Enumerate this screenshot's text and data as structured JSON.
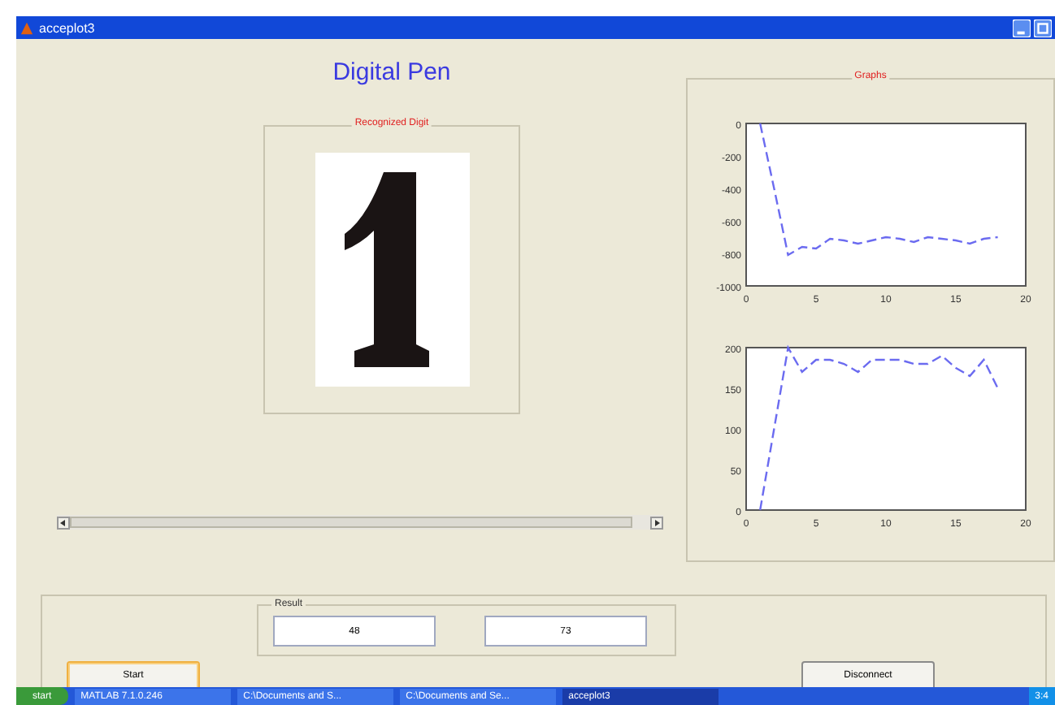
{
  "window": {
    "title": "acceplot3"
  },
  "heading": "Digital Pen",
  "digit_panel": {
    "title": "Recognized Digit"
  },
  "graphs_panel": {
    "title": "Graphs",
    "charts": [
      {
        "chart_data": {
          "type": "line",
          "x": [
            1,
            2,
            3,
            4,
            5,
            6,
            7,
            8,
            9,
            10,
            11,
            12,
            13,
            14,
            15,
            16,
            17,
            18
          ],
          "series": [
            {
              "color": "#6b6bf0",
              "line_style": "dashed",
              "values": [
                0,
                -400,
                -810,
                -760,
                -770,
                -710,
                -720,
                -740,
                -720,
                -700,
                -710,
                -730,
                -700,
                -710,
                -720,
                -740,
                -710,
                -700
              ]
            }
          ],
          "xlim": [
            0,
            20
          ],
          "ylim": [
            -1000,
            0
          ],
          "xticks": [
            0,
            5,
            10,
            15,
            20
          ],
          "yticks": [
            0,
            -200,
            -400,
            -600,
            -800,
            -1000
          ]
        }
      },
      {
        "chart_data": {
          "type": "line",
          "x": [
            1,
            2,
            3,
            4,
            5,
            6,
            7,
            8,
            9,
            10,
            11,
            12,
            13,
            14,
            15,
            16,
            17,
            18
          ],
          "series": [
            {
              "color": "#6b6bf0",
              "line_style": "dashed",
              "values": [
                0,
                100,
                200,
                170,
                185,
                185,
                180,
                170,
                185,
                185,
                185,
                180,
                180,
                190,
                175,
                165,
                185,
                150
              ]
            }
          ],
          "xlim": [
            0,
            20
          ],
          "ylim": [
            0,
            200
          ],
          "xticks": [
            0,
            5,
            10,
            15,
            20
          ],
          "yticks": [
            0,
            50,
            100,
            150,
            200
          ]
        }
      }
    ]
  },
  "result_group": {
    "title": "Result",
    "fields": [
      "48",
      "73"
    ]
  },
  "buttons": [
    {
      "label": "Start",
      "focused": true
    },
    {
      "label": "Disconnect",
      "focused": false
    }
  ],
  "taskbar": {
    "start": "start",
    "tasks": [
      {
        "label": "MATLAB 7.1.0.246",
        "selected": false
      },
      {
        "label": "C:\\Documents and S...",
        "selected": false
      },
      {
        "label": "C:\\Documents and Se...",
        "selected": false
      },
      {
        "label": "acceplot3",
        "selected": true
      }
    ],
    "clock": "3:4"
  }
}
